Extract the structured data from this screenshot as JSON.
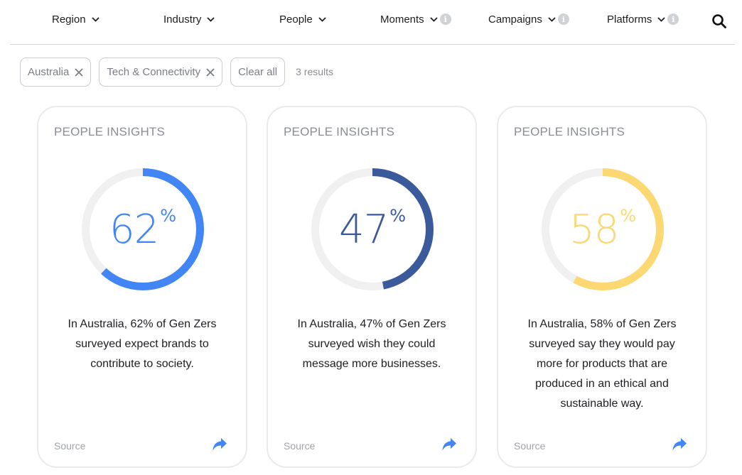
{
  "nav": {
    "items": [
      {
        "label": "Region",
        "has_info": false
      },
      {
        "label": "Industry",
        "has_info": false
      },
      {
        "label": "People",
        "has_info": false
      },
      {
        "label": "Moments",
        "has_info": true
      },
      {
        "label": "Campaigns",
        "has_info": true
      },
      {
        "label": "Platforms",
        "has_info": true
      }
    ],
    "info_glyph": "i",
    "search_icon": "search-icon"
  },
  "filters": {
    "chips": [
      {
        "label": "Australia",
        "removable": true
      },
      {
        "label": "Tech & Connectivity",
        "removable": true
      }
    ],
    "clear_all_label": "Clear all",
    "results_text": "3 results"
  },
  "cards": [
    {
      "label": "PEOPLE INSIGHTS",
      "value": 62,
      "value_text": "62",
      "percent_sign": "%",
      "color": "#4285f4",
      "description": "In Australia, 62% of Gen Zers surveyed expect brands to contribute to society.",
      "source_label": "Source"
    },
    {
      "label": "PEOPLE INSIGHTS",
      "value": 47,
      "value_text": "47",
      "percent_sign": "%",
      "color": "#3a5a9b",
      "description": "In Australia, 47% of Gen Zers surveyed wish they could message more businesses.",
      "source_label": "Source"
    },
    {
      "label": "PEOPLE INSIGHTS",
      "value": 58,
      "value_text": "58",
      "percent_sign": "%",
      "color": "#fbd872",
      "description": "In Australia, 58% of Gen Zers surveyed say they would pay more for products that are produced in an ethical and sustainable way.",
      "source_label": "Source"
    }
  ],
  "colors": {
    "ring_track": "#f0f0f0",
    "share_icon": "#4285f4"
  }
}
